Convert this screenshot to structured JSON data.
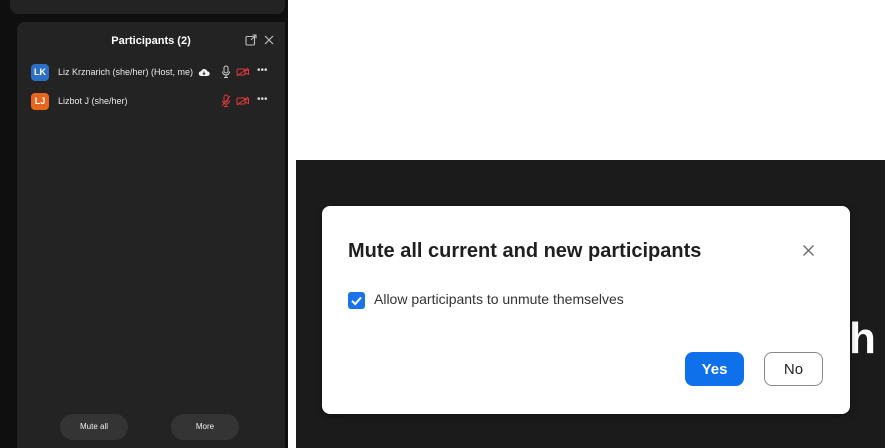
{
  "participants_panel": {
    "title": "Participants (2)",
    "header_icons": [
      "popout-icon",
      "close-icon"
    ],
    "participants": [
      {
        "initials": "LK",
        "name": "Liz Krznarich (she/her) (Host, me)",
        "avatar_color": "#2d6fc6",
        "status_icons": [
          "cloud-icon",
          "mic-icon",
          "video-off-icon",
          "more-icon"
        ]
      },
      {
        "initials": "LJ",
        "name": "Lizbot J (she/her)",
        "avatar_color": "#e8651c",
        "status_icons": [
          "mic-muted-icon",
          "video-off-icon",
          "more-icon"
        ]
      }
    ],
    "buttons": {
      "mute_all": "Mute all",
      "more": "More"
    }
  },
  "dialog": {
    "title": "Mute all current and new participants",
    "checkbox": {
      "label": "Allow participants to unmute themselves",
      "checked": true
    },
    "buttons": {
      "yes": "Yes",
      "no": "No"
    }
  },
  "background_text": "h",
  "colors": {
    "panel_bg": "#232323",
    "muted_red": "#e0383e",
    "primary_blue": "#0e71eb",
    "dialog_bg": "#ffffff"
  }
}
